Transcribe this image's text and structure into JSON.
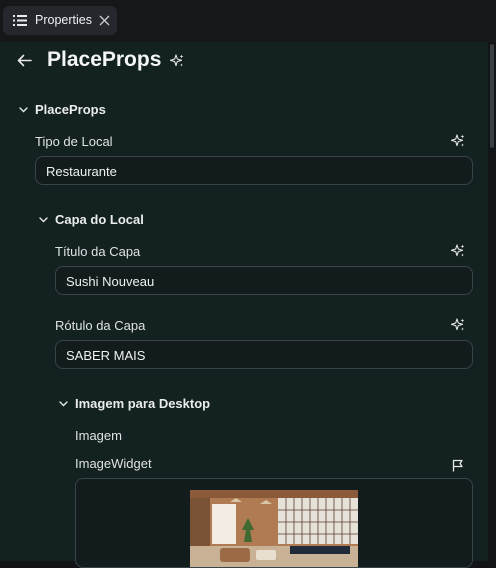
{
  "tab": {
    "label": "Properties",
    "icon": "list-icon",
    "close_icon": "close-icon"
  },
  "header": {
    "title": "PlaceProps",
    "back_icon": "arrow-left-icon",
    "ai_icon": "sparkle-icon"
  },
  "root_section": {
    "label": "PlaceProps",
    "expanded": true
  },
  "tipo_de_local": {
    "label": "Tipo de Local",
    "value": "Restaurante"
  },
  "capa_do_local": {
    "label": "Capa do Local",
    "expanded": true,
    "titulo": {
      "label": "Título da Capa",
      "value": "Sushi Nouveau"
    },
    "rotulo": {
      "label": "Rótulo da Capa",
      "value": "SABER MAIS"
    },
    "imagem_desktop": {
      "label": "Imagem para Desktop",
      "expanded": true,
      "imagem_label": "Imagem",
      "widget_label": "ImageWidget",
      "widget_icon": "flag-icon"
    }
  },
  "colors": {
    "panel_bg": "#132121",
    "tab_bg": "#24282c",
    "border": "#3a4347"
  }
}
